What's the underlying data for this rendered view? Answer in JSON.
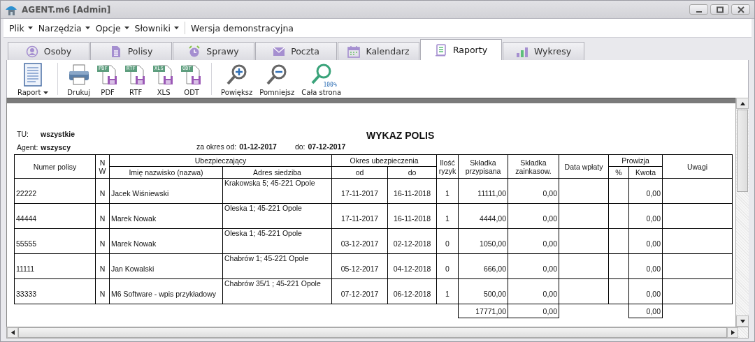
{
  "window": {
    "title": "AGENT.m6 [Admin]"
  },
  "menu": {
    "items": [
      {
        "label": "Plik",
        "dropdown": true
      },
      {
        "label": "Narzędzia",
        "dropdown": true
      },
      {
        "label": "Opcje",
        "dropdown": true
      },
      {
        "label": "Słowniki",
        "dropdown": true
      }
    ],
    "note": "Wersja demonstracyjna"
  },
  "tabs": [
    {
      "label": "Osoby",
      "selected": false
    },
    {
      "label": "Polisy",
      "selected": false
    },
    {
      "label": "Sprawy",
      "selected": false
    },
    {
      "label": "Poczta",
      "selected": false
    },
    {
      "label": "Kalendarz",
      "selected": false
    },
    {
      "label": "Raporty",
      "selected": true
    },
    {
      "label": "Wykresy",
      "selected": false
    }
  ],
  "toolbar": {
    "groups": [
      [
        {
          "kind": "report",
          "label": "Raport",
          "dropdown": true
        }
      ],
      [
        {
          "kind": "print",
          "label": "Drukuj"
        },
        {
          "kind": "export",
          "label": "PDF",
          "badge": "PDF"
        },
        {
          "kind": "export",
          "label": "RTF",
          "badge": "RTF"
        },
        {
          "kind": "export",
          "label": "XLS",
          "badge": "XLS"
        },
        {
          "kind": "export",
          "label": "ODT",
          "badge": "ODT"
        }
      ],
      [
        {
          "kind": "zoom-in",
          "label": "Powiększ"
        },
        {
          "kind": "zoom-out",
          "label": "Pomniejsz"
        },
        {
          "kind": "zoom-fit",
          "label": "Cała strona",
          "badge": "100%"
        }
      ]
    ]
  },
  "report": {
    "title": "WYKAZ POLIS",
    "tu_label": "TU:",
    "tu_value": "wszystkie",
    "agent_label": "Agent:",
    "agent_value": "wszyscy",
    "period_label": "za okres od:",
    "period_from": "01-12-2017",
    "period_to_label": "do:",
    "period_to": "07-12-2017",
    "columns": [
      {
        "label": "Numer polisy"
      },
      {
        "label": "N W"
      },
      {
        "label": "Ubezpieczający",
        "children": [
          {
            "label": "Imię nazwisko (nazwa)"
          },
          {
            "label": "Adres siedziba"
          }
        ]
      },
      {
        "label": "Okres ubezpieczenia",
        "children": [
          {
            "label": "od"
          },
          {
            "label": "do"
          }
        ]
      },
      {
        "label": "Ilość ryzyk"
      },
      {
        "label": "Składka przypisana"
      },
      {
        "label": "Składka zainkasow."
      },
      {
        "label": "Data wpłaty"
      },
      {
        "label": "Prowizja",
        "children": [
          {
            "label": "%"
          },
          {
            "label": "Kwota"
          }
        ]
      },
      {
        "label": "Uwagi"
      }
    ],
    "rows": [
      {
        "number": "22222",
        "nw": "N",
        "name": "Jacek Wiśniewski",
        "address": "Krakowska 5; 45-221 Opole",
        "from": "17-11-2017",
        "to": "16-11-2018",
        "risks": "1",
        "premium": "11111,00",
        "collected": "0,00",
        "commission": "0,00"
      },
      {
        "number": "44444",
        "nw": "N",
        "name": "Marek Nowak",
        "address": "Oleska 1; 45-221 Opole",
        "from": "17-11-2017",
        "to": "16-11-2018",
        "risks": "1",
        "premium": "4444,00",
        "collected": "0,00",
        "commission": "0,00"
      },
      {
        "number": "55555",
        "nw": "N",
        "name": "Marek Nowak",
        "address": "Oleska 1; 45-221 Opole",
        "from": "03-12-2017",
        "to": "02-12-2018",
        "risks": "0",
        "premium": "1050,00",
        "collected": "0,00",
        "commission": "0,00"
      },
      {
        "number": "11111",
        "nw": "N",
        "name": "Jan Kowalski",
        "address": "Chabrów 1; 45-221 Opole",
        "from": "05-12-2017",
        "to": "04-12-2018",
        "risks": "0",
        "premium": "666,00",
        "collected": "0,00",
        "commission": "0,00"
      },
      {
        "number": "33333",
        "nw": "N",
        "name": "M6 Software - wpis przykładowy",
        "address": "Chabrów 35/1 ; 45-221 Opole",
        "from": "07-12-2017",
        "to": "06-12-2018",
        "risks": "1",
        "premium": "500,00",
        "collected": "0,00",
        "commission": "0,00"
      }
    ],
    "totals": {
      "premium": "17771,00",
      "collected": "0,00",
      "commission": "0,00"
    }
  }
}
